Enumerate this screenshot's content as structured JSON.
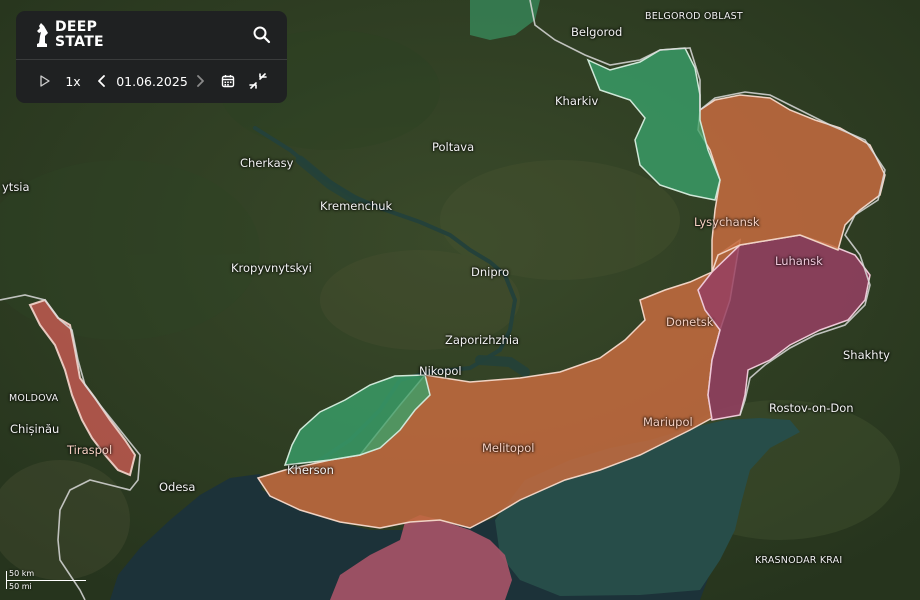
{
  "app": {
    "logo_line1": "DEEP",
    "logo_line2": "STATE"
  },
  "controls": {
    "speed": "1x",
    "date": "01.06.2025"
  },
  "icons": [
    "logo-icon",
    "search-icon",
    "play-icon",
    "chevron-left-icon",
    "chevron-right-icon",
    "calendar-icon",
    "collapse-icon"
  ],
  "colors": {
    "occupied": "#c9683f",
    "occupied_before_2022": "#9e4a6c",
    "liberated": "#3fb476",
    "border": "#d9d9d9"
  },
  "places": {
    "belgorod": "Belgorod",
    "belgorod_oblast": "BELGOROD OBLAST",
    "kharkiv": "Kharkiv",
    "poltava": "Poltava",
    "cherkasy": "Cherkasy",
    "kremenchuk": "Kremenchuk",
    "vinnytsia": "ytsia",
    "lysychansk": "Lysychansk",
    "luhansk": "Luhansk",
    "kropyvnytskyi": "Kropyvnytskyi",
    "dnipro": "Dnipro",
    "donetsk": "Donetsk",
    "zaporizhzhia": "Zaporizhzhia",
    "shakhty": "Shakhty",
    "nikopol": "Nikopol",
    "moldova": "MOLDOVA",
    "rostov": "Rostov-on-Don",
    "chisinau": "Chișinău",
    "mariupol": "Mariupol",
    "tiraspol": "Tiraspol",
    "melitopol": "Melitopol",
    "kherson": "Kherson",
    "odesa": "Odesa",
    "krasnodar": "KRASNODAR KRAI"
  },
  "scale": {
    "km": "50 km",
    "mi": "50 mi"
  }
}
